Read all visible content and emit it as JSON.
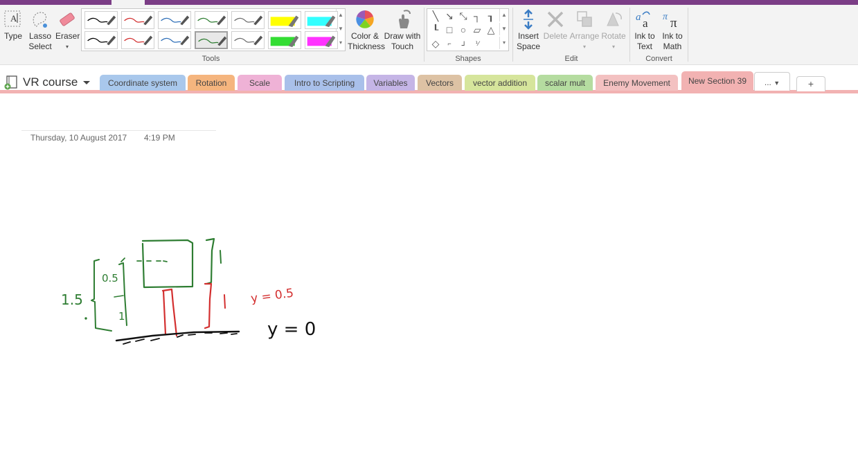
{
  "ribbon": {
    "type_label": "Type",
    "lasso_label": "Lasso Select",
    "eraser_label": "Eraser",
    "color_label": "Color & Thickness",
    "drawtouch_label": "Draw with Touch",
    "insert_space_label": "Insert Space",
    "delete_label": "Delete",
    "arrange_label": "Arrange",
    "rotate_label": "Rotate",
    "ink_text_label": "Ink to Text",
    "ink_math_label": "Ink to Math",
    "groups": {
      "tools": "Tools",
      "shapes": "Shapes",
      "edit": "Edit",
      "convert": "Convert"
    }
  },
  "pens": [
    {
      "color": "#000000"
    },
    {
      "color": "#d32f2f"
    },
    {
      "color": "#2f6fb8"
    },
    {
      "color": "#2e7d32"
    },
    {
      "color": "#6d6d6d"
    },
    {
      "color": "#ffff00",
      "highlighter": true
    },
    {
      "color": "#33ffff",
      "highlighter": true
    },
    {
      "color": "#000000"
    },
    {
      "color": "#d32f2f"
    },
    {
      "color": "#2f6fb8"
    },
    {
      "color": "#2e7d32",
      "selected": true
    },
    {
      "color": "#6d6d6d"
    },
    {
      "color": "#33dd33",
      "highlighter": true
    },
    {
      "color": "#ff33ff",
      "highlighter": true
    }
  ],
  "notebook": {
    "name": "VR course"
  },
  "sections": [
    {
      "label": "Coordinate system",
      "color": "#a9c8ec"
    },
    {
      "label": "Rotation",
      "color": "#f5b57e"
    },
    {
      "label": "Scale",
      "color": "#efb2d6"
    },
    {
      "label": "Intro to Scripting",
      "color": "#a9c0ea"
    },
    {
      "label": "Variables",
      "color": "#c5b5e6"
    },
    {
      "label": "Vectors",
      "color": "#ddc2a4"
    },
    {
      "label": "vector addition",
      "color": "#d6e59c"
    },
    {
      "label": "scalar mult",
      "color": "#b5dca0"
    },
    {
      "label": "Enemy Movement",
      "color": "#f3c1c1"
    },
    {
      "label": "New Section 39",
      "color": "#f2b2b2",
      "active": true
    }
  ],
  "more_label": "...",
  "add_label": "+",
  "page": {
    "date": "Thursday, 10 August 2017",
    "time": "4:19 PM"
  },
  "ink_text": {
    "a": "1",
    "b": "0.5",
    "c": "1.5",
    "d": "1",
    "e": "1",
    "f": "y = 0.5",
    "g": "y = 0"
  }
}
